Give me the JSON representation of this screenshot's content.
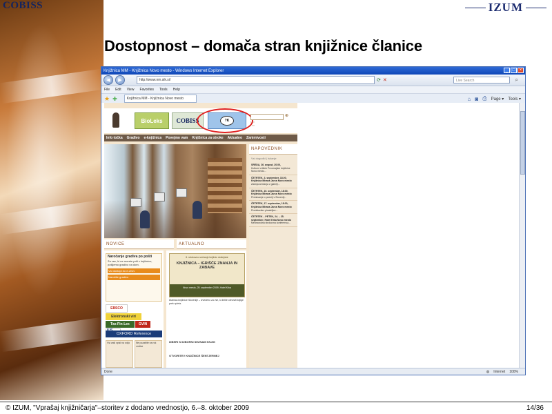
{
  "slide": {
    "cobiss_logo": "COBISS",
    "izum_logo": "IZUM",
    "title": "Dostopnost – domača stran knjižnice članice",
    "footer_text": "© IZUM, \"Vprašaj knjižničarja\"–storitev z dodano vrednostjo, 6.–8. oktober 2009",
    "page": "14/36"
  },
  "browser": {
    "window_title": "Knjižnica MM - Knjižnica Novo mesto - Windows Internet Explorer",
    "url": "http://www.nm.sik.si/",
    "search_placeholder": "Live Search",
    "menu": [
      "File",
      "Edit",
      "View",
      "Favorites",
      "Tools",
      "Help"
    ],
    "tab_label": "Knjižnica MM - Knjižnica Novo mesto",
    "tools": [
      "Page ▾",
      "Tools ▾"
    ],
    "status_left": "Done",
    "status_right": [
      "Internet",
      "100%"
    ],
    "icons": {
      "back": "back-arrow-icon",
      "forward": "forward-arrow-icon",
      "refresh": "refresh-icon",
      "stop": "stop-icon"
    }
  },
  "site": {
    "banner_biolexis": "BioLeks",
    "banner_cobiss": "COBISS",
    "banner_vk": "?K",
    "nav": [
      "Info točka",
      "Gradivo",
      "e-knjižnica",
      "Povejmo vam",
      "Knjižnica za otroke",
      "Aktualno",
      "Zanimivosti"
    ],
    "section_novice": "NOVICE",
    "section_aktualno": "AKTUALNO",
    "calendar": {
      "title": "NAPOVEDNIK",
      "sub": "Vsi dogodki | Iskanje",
      "events": [
        {
          "head": "SREDA, 26. avgust, 20.00,",
          "body": "Kulturni vrtiček Prvomajske knjižnice Novo mesto..."
        },
        {
          "head": "ČETRTEK, 3. september, 18.00, Knjižnica Mirana Jarca Novo mesto",
          "body": "Zadnja srečanja v galeriji..."
        },
        {
          "head": "ČETRTEK, 10. september, 18.00, Knjižnica Mirana Jarca Novo mesto",
          "body": "Predavanje o poeziji v Sloveniji..."
        },
        {
          "head": "ČETRTEK, 17. september, 18.00, Knjižnica Mirana Jarca Novo mesto",
          "body": "Predstavitev pisateljice..."
        },
        {
          "head": "ČETRTEK – PETEK, 24. – 25. september, Hotel Krka Novo mesto",
          "body": "Mednarodna strokovna konferenca..."
        }
      ]
    },
    "ad": {
      "title": "Naročanje gradiva po pošti",
      "body": "Za vse, ki ne morete priti v knjižnico, pošljemo gradivo na dom.",
      "btn1": "Vsi dostopi do e-virov",
      "btn2": "Naročite gradivo"
    },
    "logos": [
      "EBSCO",
      "Elektronski viri",
      "Tax-Fin-Lex",
      "GVIN",
      "IUS INFO"
    ],
    "oxford": "OXFORD Reference",
    "small_box_1": "Vsi vaši vpisi na voljo",
    "small_box_2": "Ne pozabite na rok vrnitve",
    "promo": {
      "top": "6. strokovno srečanje knjižnic dolenjske",
      "big": "KNJIŽNICA – IGRIŠČE ZNANJA IN ZABAVE",
      "strip": "Novo mesto, 25. september 2009, Hotel Krka"
    },
    "akt_text": "Dialnica knjižnice Slovenije – Izvedeno za vse, ki želite obnoviti knjige prek spleta.",
    "akt_head1": "IZBERI SI IZBORNI SEZNAM KNJIG",
    "akt_head2": "OTVORITEV KNJIŽNICE ŠENTJERNEJ"
  }
}
